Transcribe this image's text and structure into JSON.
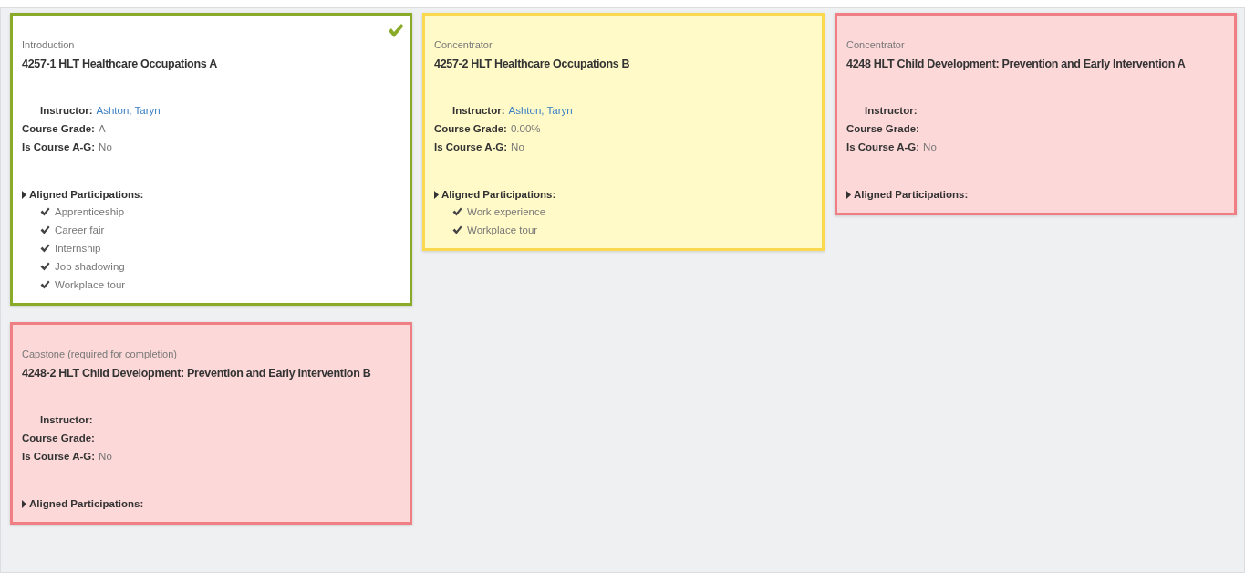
{
  "courses": [
    {
      "kind": "complete",
      "category": "Introduction",
      "title": "4257-1 HLT Healthcare Occupations A",
      "instructor_label": "Instructor:",
      "instructor": "Ashton, Taryn",
      "grade_label": "Course Grade:",
      "grade": "A-",
      "ag_label": "Is Course A-G:",
      "ag": "No",
      "participations_label": "Aligned Participations:",
      "participations": [
        "Apprenticeship",
        "Career fair",
        "Internship",
        "Job shadowing",
        "Workplace tour"
      ]
    },
    {
      "kind": "in_progress",
      "category": "Concentrator",
      "title": "4257-2 HLT Healthcare Occupations B",
      "instructor_label": "Instructor:",
      "instructor": "Ashton, Taryn",
      "grade_label": "Course Grade:",
      "grade": "0.00%",
      "ag_label": "Is Course A-G:",
      "ag": "No",
      "participations_label": "Aligned Participations:",
      "participations": [
        "Work experience",
        "Workplace tour"
      ]
    },
    {
      "kind": "not_started",
      "category": "Concentrator",
      "title": "4248 HLT Child Development: Prevention and Early Intervention A",
      "instructor_label": "Instructor:",
      "grade_label": "Course Grade:",
      "ag_label": "Is Course A-G:",
      "ag": "No",
      "participations_label": "Aligned Participations:"
    },
    {
      "kind": "not_started",
      "category": "Capstone (required for completion)",
      "title": "4248-2 HLT Child Development: Prevention and Early Intervention B",
      "instructor_label": "Instructor:",
      "grade_label": "Course Grade:",
      "ag_label": "Is Course A-G:",
      "ag": "No",
      "participations_label": "Aligned Participations:"
    }
  ]
}
